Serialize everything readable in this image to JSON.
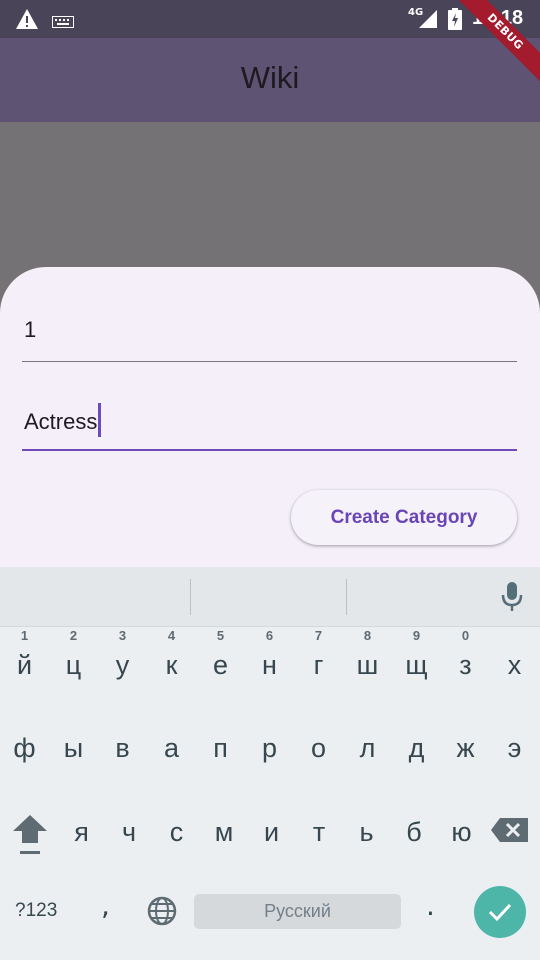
{
  "status_bar": {
    "network": "4G",
    "time": "16:18",
    "icons": [
      "warning-icon",
      "keyboard-icon",
      "signal-icon",
      "battery-charging-icon"
    ]
  },
  "debug_banner": "DEBUG",
  "app_bar": {
    "title": "Wiki"
  },
  "sheet": {
    "field1_value": "1",
    "field2_value": "Actress",
    "create_button_label": "Create Category"
  },
  "keyboard": {
    "row1": [
      {
        "key": "й",
        "hint": "1"
      },
      {
        "key": "ц",
        "hint": "2"
      },
      {
        "key": "у",
        "hint": "3"
      },
      {
        "key": "к",
        "hint": "4"
      },
      {
        "key": "е",
        "hint": "5"
      },
      {
        "key": "н",
        "hint": "6"
      },
      {
        "key": "г",
        "hint": "7"
      },
      {
        "key": "ш",
        "hint": "8"
      },
      {
        "key": "щ",
        "hint": "9"
      },
      {
        "key": "з",
        "hint": "0"
      },
      {
        "key": "х",
        "hint": ""
      }
    ],
    "row2": [
      "ф",
      "ы",
      "в",
      "а",
      "п",
      "р",
      "о",
      "л",
      "д",
      "ж",
      "э"
    ],
    "row3": [
      "я",
      "ч",
      "с",
      "м",
      "и",
      "т",
      "ь",
      "б",
      "ю"
    ],
    "symbols_label": "?123",
    "comma": ",",
    "space_label": "Русский",
    "period": ".",
    "accent_color": "#4db6a8"
  }
}
